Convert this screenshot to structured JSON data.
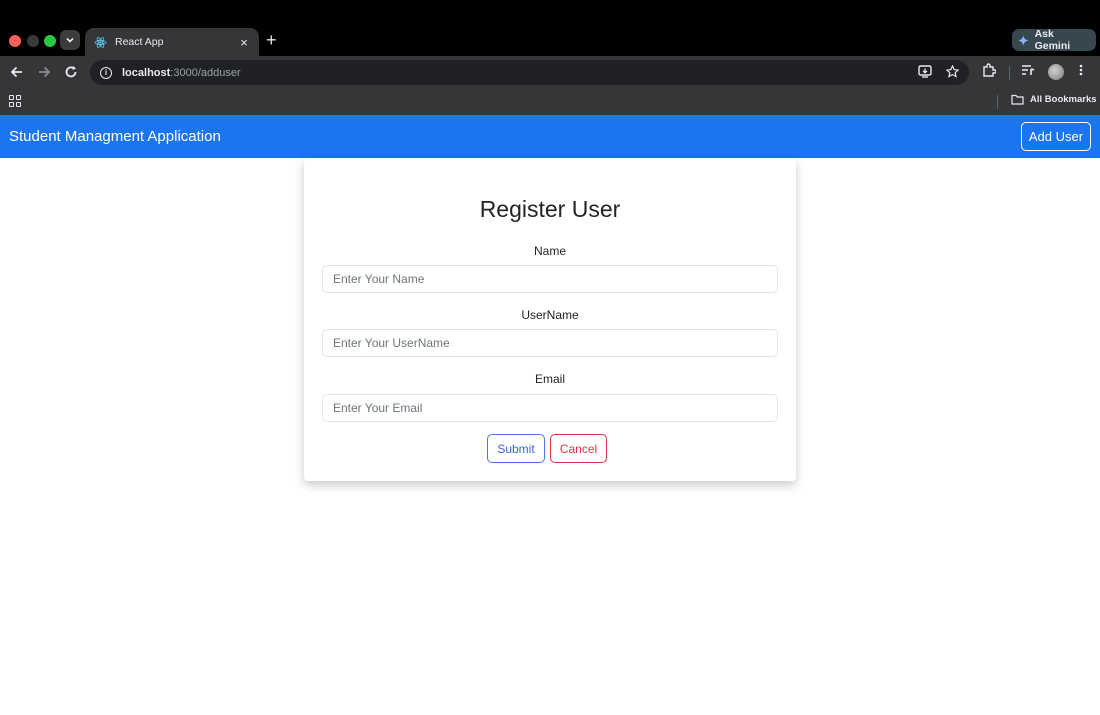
{
  "browser": {
    "tab_title": "React App",
    "tab_close": "×",
    "new_tab": "+",
    "tab_search": "⌄",
    "gemini_label": "Ask Gemini",
    "url_host": "localhost",
    "url_path": ":3000/adduser",
    "bookmarks_label": "All Bookmarks"
  },
  "navbar": {
    "brand": "Student Managment Application",
    "add_user_label": "Add User",
    "color": "#1b74f0"
  },
  "form": {
    "title": "Register User",
    "fields": [
      {
        "label": "Name",
        "placeholder": "Enter Your Name",
        "value": ""
      },
      {
        "label": "UserName",
        "placeholder": "Enter Your UserName",
        "value": ""
      },
      {
        "label": "Email",
        "placeholder": "Enter Your Email",
        "value": ""
      }
    ],
    "submit_label": "Submit",
    "cancel_label": "Cancel"
  },
  "colors": {
    "submit_border": "#4a77e6",
    "cancel_border": "#dc3545"
  },
  "icons": [
    "back-arrow-icon",
    "forward-arrow-icon",
    "reload-icon",
    "site-info-icon",
    "install-icon",
    "bookmark-star-icon",
    "extensions-icon",
    "reading-list-icon",
    "profile-avatar",
    "menu-kebab-icon",
    "apps-grid-icon",
    "folder-icon",
    "react-logo-icon",
    "gemini-sparkle-icon"
  ]
}
